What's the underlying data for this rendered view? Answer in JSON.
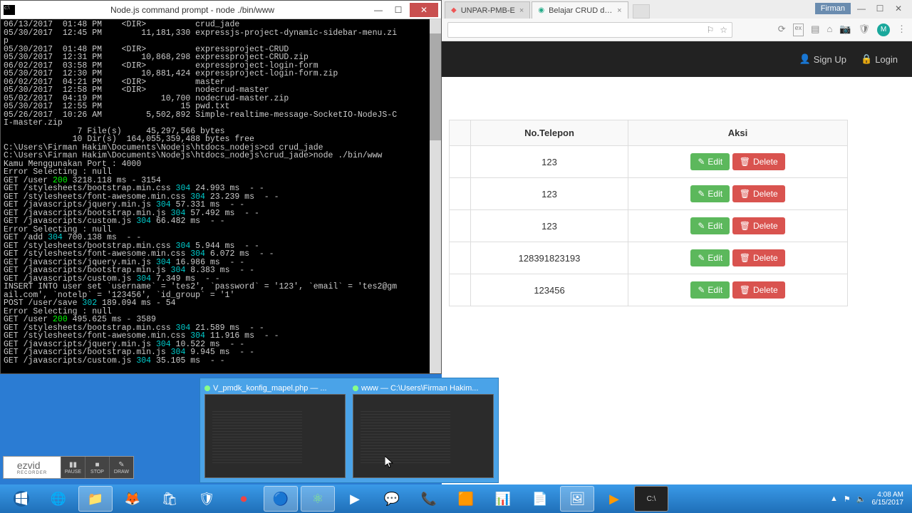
{
  "terminal": {
    "title": "Node.js command prompt - node  ./bin/www",
    "lines": [
      {
        "t": "06/13/2017  01:48 PM    <DIR>          crud_jade"
      },
      {
        "t": "05/30/2017  12:45 PM        11,181,330 expressjs-project-dynamic-sidebar-menu.zi"
      },
      {
        "t": "p"
      },
      {
        "t": "05/30/2017  01:48 PM    <DIR>          expressproject-CRUD"
      },
      {
        "t": "05/30/2017  12:31 PM        10,868,298 expressproject-CRUD.zip"
      },
      {
        "t": "06/02/2017  03:58 PM    <DIR>          expressproject-login-form"
      },
      {
        "t": "05/30/2017  12:30 PM        10,881,424 expressproject-login-form.zip"
      },
      {
        "t": "06/02/2017  04:21 PM    <DIR>          master"
      },
      {
        "t": "05/30/2017  12:58 PM    <DIR>          nodecrud-master"
      },
      {
        "t": "05/02/2017  04:19 PM            10,700 nodecrud-master.zip"
      },
      {
        "t": "05/30/2017  12:55 PM                15 pwd.txt"
      },
      {
        "t": "05/26/2017  10:26 AM         5,502,892 Simple-realtime-message-SocketIO-NodeJS-C"
      },
      {
        "t": "I-master.zip"
      },
      {
        "t": "               7 File(s)     45,297,566 bytes"
      },
      {
        "t": "              10 Dir(s)  164,055,359,488 bytes free"
      },
      {
        "t": ""
      },
      {
        "t": "C:\\Users\\Firman Hakim\\Documents\\Nodejs\\htdocs_nodejs>cd crud_jade"
      },
      {
        "t": ""
      },
      {
        "t": "C:\\Users\\Firman Hakim\\Documents\\Nodejs\\htdocs_nodejs\\crud_jade>node ./bin/www"
      },
      {
        "t": "Kamu Menggunakan Port : 4000"
      },
      {
        "t": "Error Selecting : null"
      },
      {
        "seg": [
          {
            "t": "GET /user "
          },
          {
            "t": "200",
            "c": "c200"
          },
          {
            "t": " 3218.118 ms - 3154"
          }
        ]
      },
      {
        "seg": [
          {
            "t": "GET /stylesheets/bootstrap.min.css "
          },
          {
            "t": "304",
            "c": "c304"
          },
          {
            "t": " 24.993 ms  - -"
          }
        ]
      },
      {
        "seg": [
          {
            "t": "GET /stylesheets/font-awesome.min.css "
          },
          {
            "t": "304",
            "c": "c304"
          },
          {
            "t": " 23.239 ms  - -"
          }
        ]
      },
      {
        "seg": [
          {
            "t": "GET /javascripts/jquery.min.js "
          },
          {
            "t": "304",
            "c": "c304"
          },
          {
            "t": " 57.331 ms  - -"
          }
        ]
      },
      {
        "seg": [
          {
            "t": "GET /javascripts/bootstrap.min.js "
          },
          {
            "t": "304",
            "c": "c304"
          },
          {
            "t": " 57.492 ms  - -"
          }
        ]
      },
      {
        "seg": [
          {
            "t": "GET /javascripts/custom.js "
          },
          {
            "t": "304",
            "c": "c304"
          },
          {
            "t": " 66.482 ms  - -"
          }
        ]
      },
      {
        "t": "Error Selecting : null"
      },
      {
        "seg": [
          {
            "t": "GET /add "
          },
          {
            "t": "304",
            "c": "c304"
          },
          {
            "t": " 700.138 ms  - -"
          }
        ]
      },
      {
        "seg": [
          {
            "t": "GET /stylesheets/bootstrap.min.css "
          },
          {
            "t": "304",
            "c": "c304"
          },
          {
            "t": " 5.944 ms  - -"
          }
        ]
      },
      {
        "seg": [
          {
            "t": "GET /stylesheets/font-awesome.min.css "
          },
          {
            "t": "304",
            "c": "c304"
          },
          {
            "t": " 6.072 ms  - -"
          }
        ]
      },
      {
        "seg": [
          {
            "t": "GET /javascripts/jquery.min.js "
          },
          {
            "t": "304",
            "c": "c304"
          },
          {
            "t": " 16.986 ms  - -"
          }
        ]
      },
      {
        "seg": [
          {
            "t": "GET /javascripts/bootstrap.min.js "
          },
          {
            "t": "304",
            "c": "c304"
          },
          {
            "t": " 8.383 ms  - -"
          }
        ]
      },
      {
        "seg": [
          {
            "t": "GET /javascripts/custom.js "
          },
          {
            "t": "304",
            "c": "c304"
          },
          {
            "t": " 7.349 ms  - -"
          }
        ]
      },
      {
        "t": "INSERT INTO user set `username` = 'tes2', `password` = '123', `email` = 'tes2@gm"
      },
      {
        "t": "ail.com', `notelp` = '123456', `id_group` = '1'"
      },
      {
        "seg": [
          {
            "t": "POST /user/save "
          },
          {
            "t": "302",
            "c": "c302"
          },
          {
            "t": " 189.094 ms - 54"
          }
        ]
      },
      {
        "t": "Error Selecting : null"
      },
      {
        "seg": [
          {
            "t": "GET /user "
          },
          {
            "t": "200",
            "c": "c200"
          },
          {
            "t": " 495.625 ms - 3589"
          }
        ]
      },
      {
        "seg": [
          {
            "t": "GET /stylesheets/bootstrap.min.css "
          },
          {
            "t": "304",
            "c": "c304"
          },
          {
            "t": " 21.589 ms  - -"
          }
        ]
      },
      {
        "seg": [
          {
            "t": "GET /stylesheets/font-awesome.min.css "
          },
          {
            "t": "304",
            "c": "c304"
          },
          {
            "t": " 11.916 ms  - -"
          }
        ]
      },
      {
        "seg": [
          {
            "t": "GET /javascripts/jquery.min.js "
          },
          {
            "t": "304",
            "c": "c304"
          },
          {
            "t": " 10.522 ms  - -"
          }
        ]
      },
      {
        "seg": [
          {
            "t": "GET /javascripts/bootstrap.min.js "
          },
          {
            "t": "304",
            "c": "c304"
          },
          {
            "t": " 9.945 ms  - -"
          }
        ]
      },
      {
        "seg": [
          {
            "t": "GET /javascripts/custom.js "
          },
          {
            "t": "304",
            "c": "c304"
          },
          {
            "t": " 35.105 ms  - -"
          }
        ]
      }
    ]
  },
  "browser": {
    "identity": "Firman",
    "tabs": [
      {
        "label": "UNPAR-PMB-E",
        "active": false
      },
      {
        "label": "Belajar CRUD dengan Vi",
        "active": true
      }
    ],
    "avatar_letter": "M",
    "page": {
      "nav_signup": "Sign Up",
      "nav_login": "Login",
      "headers": [
        "No.Telepon",
        "Aksi"
      ],
      "edit_label": "Edit",
      "delete_label": "Delete",
      "rows": [
        {
          "phone": "123"
        },
        {
          "phone": "123"
        },
        {
          "phone": "123"
        },
        {
          "phone": "128391823193"
        },
        {
          "phone": "123456"
        }
      ]
    }
  },
  "thumbnails": {
    "t1": "V_pmdk_konfig_mapel.php — ...",
    "t2": "www — C:\\Users\\Firman Hakim..."
  },
  "ezvid": {
    "logo": "ezvid",
    "sub": "RECORDER",
    "pause": "PAUSE",
    "stop": "STOP",
    "draw": "DRAW"
  },
  "tray": {
    "time": "4:08 AM",
    "date": "6/15/2017"
  }
}
